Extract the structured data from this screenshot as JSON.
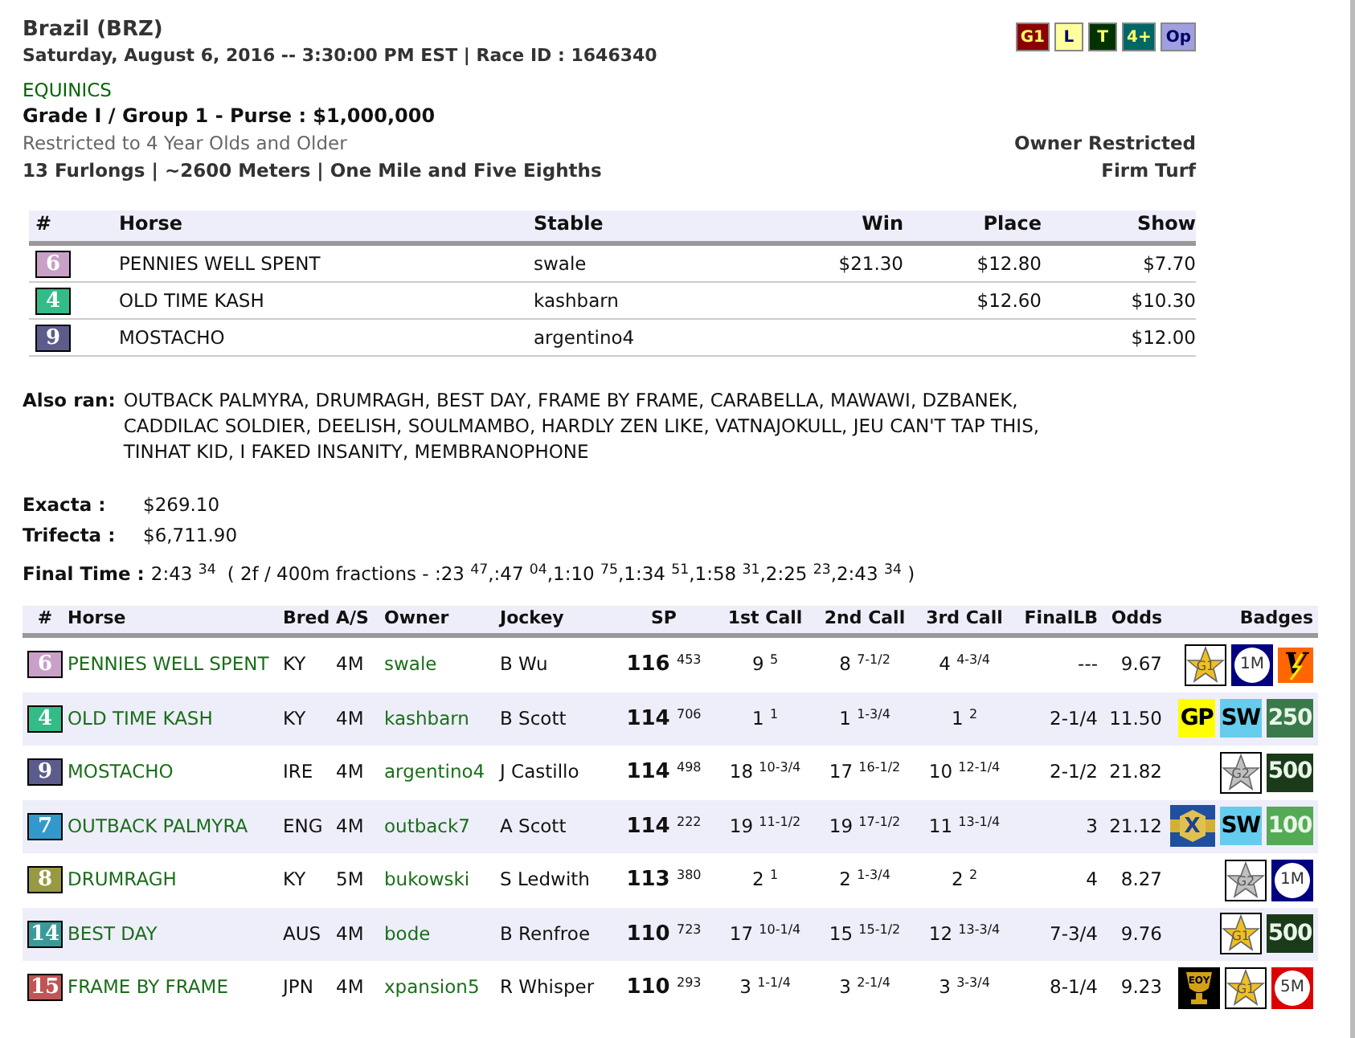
{
  "race": {
    "title": "Brazil (BRZ)",
    "datetime": "Saturday, August 6, 2016 -- 3:30:00 PM EST | Race ID : 1646340",
    "category": "EQUINICS",
    "grade": "Grade I / Group 1 - Purse : $1,000,000",
    "restriction": "Restricted to 4 Year Olds and Older",
    "distance": "13 Furlongs | ~2600 Meters | One Mile and Five Eighths",
    "owner_rule": "Owner Restricted",
    "surface": "Firm Turf",
    "tags": [
      {
        "text": "G1",
        "color": "#8b0000"
      },
      {
        "text": "L",
        "color": "#ffffa0"
      },
      {
        "text": "T",
        "color": "#003300"
      },
      {
        "text": "4+",
        "color": "#006666"
      },
      {
        "text": "Op",
        "color": "#a0a0e0"
      }
    ]
  },
  "payouts": {
    "columns": [
      "#",
      "Horse",
      "Stable",
      "Win",
      "Place",
      "Show"
    ],
    "rows": [
      {
        "post": "6",
        "color": "#c8a0c8",
        "horse": "PENNIES WELL SPENT",
        "stable": "swale",
        "win": "$21.30",
        "place": "$12.80",
        "show": "$7.70"
      },
      {
        "post": "4",
        "color": "#33bb88",
        "horse": "OLD TIME KASH",
        "stable": "kashbarn",
        "place": "$12.60",
        "show": "$10.30"
      },
      {
        "post": "9",
        "color": "#5c5c8c",
        "horse": "MOSTACHO",
        "stable": "argentino4",
        "show": "$12.00"
      }
    ]
  },
  "also_ran": {
    "label": "Also ran:",
    "text": "OUTBACK PALMYRA, DRUMRAGH, BEST DAY, FRAME BY FRAME, CARABELLA, MAWAWI, DZBANEK, CADDILAC SOLDIER, DEELISH, SOULMAMBO, HARDLY ZEN LIKE, VATNAJOKULL, JEU CAN'T TAP THIS, TINHAT KID, I FAKED INSANITY, MEMBRANOPHONE"
  },
  "exotics": [
    {
      "label": "Exacta :",
      "value": "$269.10"
    },
    {
      "label": "Trifecta :",
      "value": "$6,711.90"
    }
  ],
  "final_time": {
    "label": "Final Time :",
    "value": "2:43 $^{34}$",
    "fractions": "( 2f / 400m fractions - :23 $^{47}$,:47 $^{04}$,1:10 $^{75}$,1:34 $^{51}$,1:58 $^{31}$,2:25 $^{23}$,2:43 $^{34}$ )"
  },
  "results": {
    "columns": [
      "#",
      "Horse",
      "Bred",
      "A/S",
      "Owner",
      "Jockey",
      "SP",
      "1st Call",
      "2nd Call",
      "3rd Call",
      "FinalLB",
      "Odds",
      "Badges"
    ],
    "rows": [
      {
        "post": "6",
        "color": "#c8a0c8",
        "horse": "PENNIES WELL SPENT",
        "bred": "KY",
        "as": "4M",
        "owner": "swale",
        "jockey": "B Wu",
        "sp": "**116** $^{453}$",
        "call1": "9 $^{5}$",
        "call2": "8 $^{7-1/2}$",
        "call3": "4 $^{4-3/4}$",
        "final_lb": "---",
        "odds": "9.67",
        "badges": [
          {
            "kind": "star",
            "text": "G1",
            "color": "#f0c020"
          },
          {
            "kind": "circle",
            "text": "1M",
            "color": "#000080"
          },
          {
            "kind": "bolt",
            "text": "V",
            "color": "#ff6600"
          }
        ]
      },
      {
        "post": "4",
        "color": "#33bb88",
        "horse": "OLD TIME KASH",
        "bred": "KY",
        "as": "4M",
        "owner": "kashbarn",
        "jockey": "B Scott",
        "sp": "**114** $^{706}$",
        "call1": "1 $^{1}$",
        "call2": "1 $^{1-3/4}$",
        "call3": "1 $^{2}$",
        "final_lb": "2-1/4",
        "odds": "11.50",
        "badges": [
          {
            "kind": "tile",
            "text": "GP",
            "color": "#ffff00"
          },
          {
            "kind": "tile",
            "text": "SW",
            "color": "#66ccee"
          },
          {
            "kind": "tile",
            "text": "250",
            "color": "#3a7a4a"
          }
        ]
      },
      {
        "post": "9",
        "color": "#5c5c8c",
        "horse": "MOSTACHO",
        "bred": "IRE",
        "as": "4M",
        "owner": "argentino4",
        "jockey": "J Castillo",
        "sp": "**114** $^{498}$",
        "call1": "18 $^{10-3/4}$",
        "call2": "17 $^{16-1/2}$",
        "call3": "10 $^{12-1/4}$",
        "final_lb": "2-1/2",
        "odds": "21.82",
        "badges": [
          {
            "kind": "star",
            "text": "G2",
            "color": "#c0c0c0"
          },
          {
            "kind": "tile",
            "text": "500",
            "color": "#1a3a1a"
          }
        ]
      },
      {
        "post": "7",
        "color": "#3399cc",
        "horse": "OUTBACK PALMYRA",
        "bred": "ENG",
        "as": "4M",
        "owner": "outback7",
        "jockey": "A Scott",
        "sp": "**114** $^{222}$",
        "call1": "19 $^{11-1/2}$",
        "call2": "19 $^{17-1/2}$",
        "call3": "11 $^{13-1/4}$",
        "final_lb": "3",
        "odds": "21.12",
        "badges": [
          {
            "kind": "belt",
            "text": "X",
            "color": "#1f4f9f"
          },
          {
            "kind": "tile",
            "text": "SW",
            "color": "#66ccee"
          },
          {
            "kind": "tile",
            "text": "100",
            "color": "#55aa55"
          }
        ]
      },
      {
        "post": "8",
        "color": "#999944",
        "horse": "DRUMRAGH",
        "bred": "KY",
        "as": "5M",
        "owner": "bukowski",
        "jockey": "S Ledwith",
        "sp": "**113** $^{380}$",
        "call1": "2 $^{1}$",
        "call2": "2 $^{1-3/4}$",
        "call3": "2 $^{2}$",
        "final_lb": "4",
        "odds": "8.27",
        "badges": [
          {
            "kind": "star",
            "text": "G2",
            "color": "#c0c0c0"
          },
          {
            "kind": "circle",
            "text": "1M",
            "color": "#000080"
          }
        ]
      },
      {
        "post": "14",
        "color": "#3a9a9a",
        "horse": "BEST DAY",
        "bred": "AUS",
        "as": "4M",
        "owner": "bode",
        "jockey": "B Renfroe",
        "sp": "**110** $^{723}$",
        "call1": "17 $^{10-1/4}$",
        "call2": "15 $^{15-1/2}$",
        "call3": "12 $^{13-3/4}$",
        "final_lb": "7-3/4",
        "odds": "9.76",
        "badges": [
          {
            "kind": "star",
            "text": "G1",
            "color": "#f0c020"
          },
          {
            "kind": "tile",
            "text": "500",
            "color": "#1a3a1a"
          }
        ]
      },
      {
        "post": "15",
        "color": "#c05555",
        "horse": "FRAME BY FRAME",
        "bred": "JPN",
        "as": "4M",
        "owner": "xpansion5",
        "jockey": "R Whisper",
        "sp": "**110** $^{293}$",
        "call1": "3 $^{1-1/4}$",
        "call2": "3 $^{2-1/4}$",
        "call3": "3 $^{3-3/4}$",
        "final_lb": "8-1/4",
        "odds": "9.23",
        "badges": [
          {
            "kind": "trophy",
            "text": "EOY",
            "color": "#d4a017"
          },
          {
            "kind": "star",
            "text": "G1",
            "color": "#f0c020"
          },
          {
            "kind": "circle",
            "text": "5M",
            "color": "#dd0000"
          }
        ]
      }
    ]
  }
}
